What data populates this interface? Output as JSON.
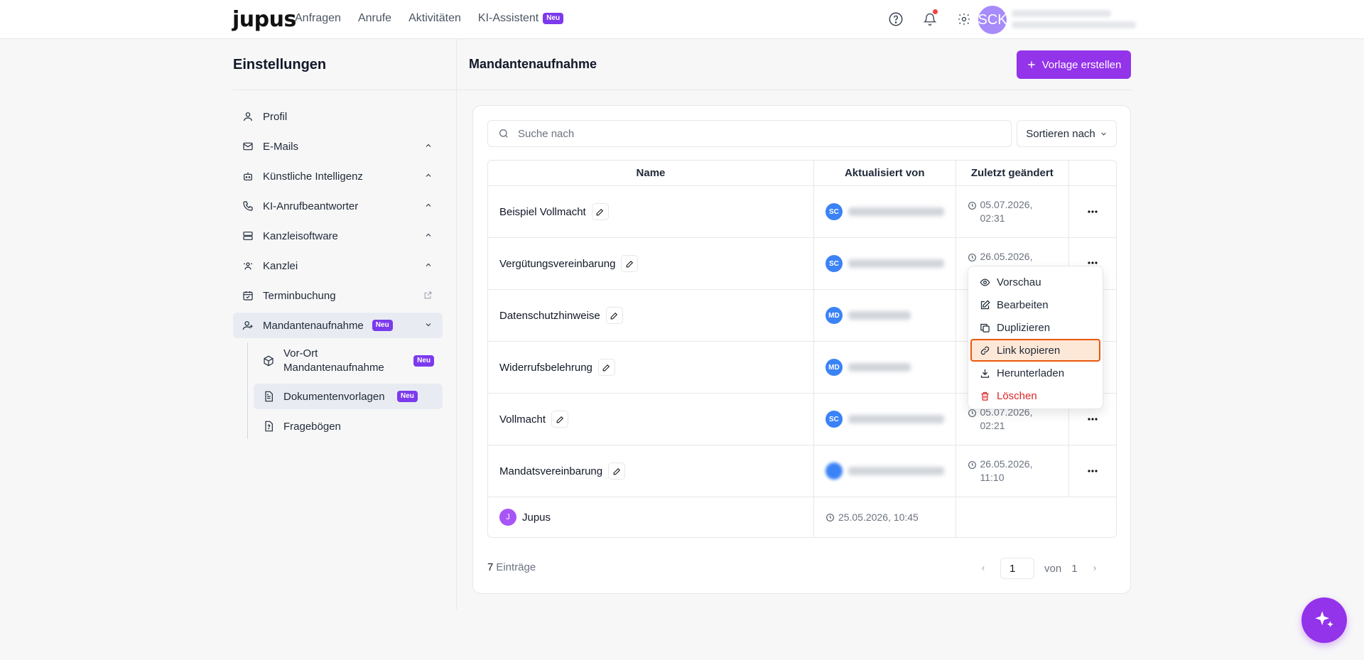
{
  "topbar": {
    "logo": "jupus",
    "nav": [
      {
        "label": "Anfragen"
      },
      {
        "label": "Anrufe"
      },
      {
        "label": "Aktivitäten"
      },
      {
        "label": "KI-Assistent",
        "badge": "Neu"
      }
    ],
    "avatar_initials": "SCK"
  },
  "sidebar": {
    "title": "Einstellungen",
    "items": [
      {
        "label": "Profil",
        "icon": "user-icon"
      },
      {
        "label": "E-Mails",
        "icon": "mail-icon"
      },
      {
        "label": "Künstliche Intelligenz",
        "icon": "robot-icon"
      },
      {
        "label": "KI-Anrufbeantworter",
        "icon": "phone-icon"
      },
      {
        "label": "Kanzleisoftware",
        "icon": "server-icon"
      },
      {
        "label": "Kanzlei",
        "icon": "team-icon"
      },
      {
        "label": "Terminbuchung",
        "icon": "calendar-icon"
      },
      {
        "label": "Mandantenaufnahme",
        "icon": "user-plus-icon",
        "badge": "Neu"
      }
    ],
    "sub_items": [
      {
        "label": "Vor-Ort Mandantenaufnahme",
        "icon": "box-icon",
        "badge": "Neu"
      },
      {
        "label": "Dokumentenvorlagen",
        "icon": "document-icon",
        "badge": "Neu"
      },
      {
        "label": "Fragebögen",
        "icon": "questionnaire-icon"
      }
    ]
  },
  "main": {
    "title": "Mandantenaufnahme",
    "create_button": "Vorlage erstellen",
    "search_placeholder": "Suche nach",
    "sort_label": "Sortieren nach",
    "columns": [
      "Name",
      "Aktualisiert von",
      "Zuletzt geändert"
    ],
    "rows": [
      {
        "name": "Beispiel Vollmacht",
        "avatar": "SC",
        "date_line1": "05.07.2026,",
        "date_line2": "02:31"
      },
      {
        "name": "Vergütungsvereinbarung",
        "avatar": "SC",
        "date_line1": "26.05.2026,",
        "date_line2": ""
      },
      {
        "name": "Datenschutzhinweise",
        "avatar": "MD",
        "date_line1": "",
        "date_line2": ""
      },
      {
        "name": "Widerrufsbelehrung",
        "avatar": "MD",
        "date_line1": "",
        "date_line2": ""
      },
      {
        "name": "Vollmacht",
        "avatar": "SC",
        "date_line1": "05.07.2026,",
        "date_line2": "02:21"
      },
      {
        "name": "Mandatsvereinbarung",
        "avatar": "",
        "date_line1": "26.05.2026,",
        "date_line2": "11:10"
      }
    ],
    "last_row": {
      "avatar": "J",
      "name": "Jupus",
      "date": "25.05.2026, 10:45"
    },
    "entries_count": "7",
    "entries_label": "Einträge",
    "page_current": "1",
    "page_of": "von",
    "page_total": "1"
  },
  "context_menu": {
    "items": [
      {
        "label": "Vorschau",
        "icon": "eye-icon"
      },
      {
        "label": "Bearbeiten",
        "icon": "edit-icon"
      },
      {
        "label": "Duplizieren",
        "icon": "copy-icon"
      },
      {
        "label": "Link kopieren",
        "icon": "link-icon"
      },
      {
        "label": "Herunterladen",
        "icon": "download-icon"
      },
      {
        "label": "Löschen",
        "icon": "trash-icon"
      }
    ]
  },
  "colors": {
    "brand": "#9333ea",
    "badge": "#7c3aed",
    "avatar_blue": "#3b82f6",
    "danger": "#dc2626",
    "highlight_border": "#ea580c"
  }
}
